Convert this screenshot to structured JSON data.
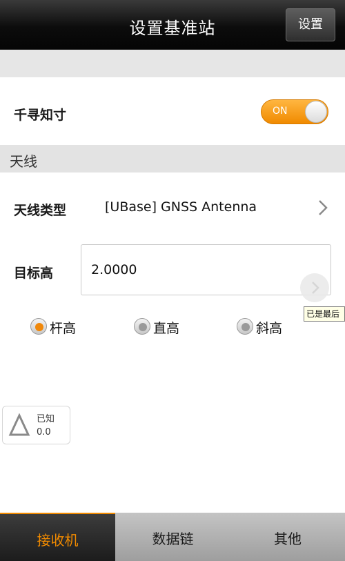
{
  "header": {
    "title": "设置基准站",
    "action_label": "设置"
  },
  "qianxun": {
    "label": "千寻知寸",
    "toggle_text": "ON",
    "toggle_on": true
  },
  "section_antenna": {
    "label": "天线"
  },
  "antenna_type": {
    "label": "天线类型",
    "value": "[UBase] GNSS Antenna",
    "icon": "chevron-right-icon"
  },
  "target_height": {
    "label": "目标高",
    "value": "2.0000"
  },
  "tooltip": {
    "text": "已是最后"
  },
  "height_modes": [
    {
      "label": "杆高",
      "selected": true
    },
    {
      "label": "直高",
      "selected": false
    },
    {
      "label": "斜高",
      "selected": false
    }
  ],
  "known_point": {
    "label": "已知",
    "value": "0.0",
    "icon": "triangle-icon"
  },
  "tabs": [
    {
      "label": "接收机",
      "active": true
    },
    {
      "label": "数据链",
      "active": false
    },
    {
      "label": "其他",
      "active": false
    }
  ],
  "colors": {
    "accent": "#f08a00",
    "header_bg": "#0c0c0c",
    "section_bg": "#e3e3e3"
  }
}
